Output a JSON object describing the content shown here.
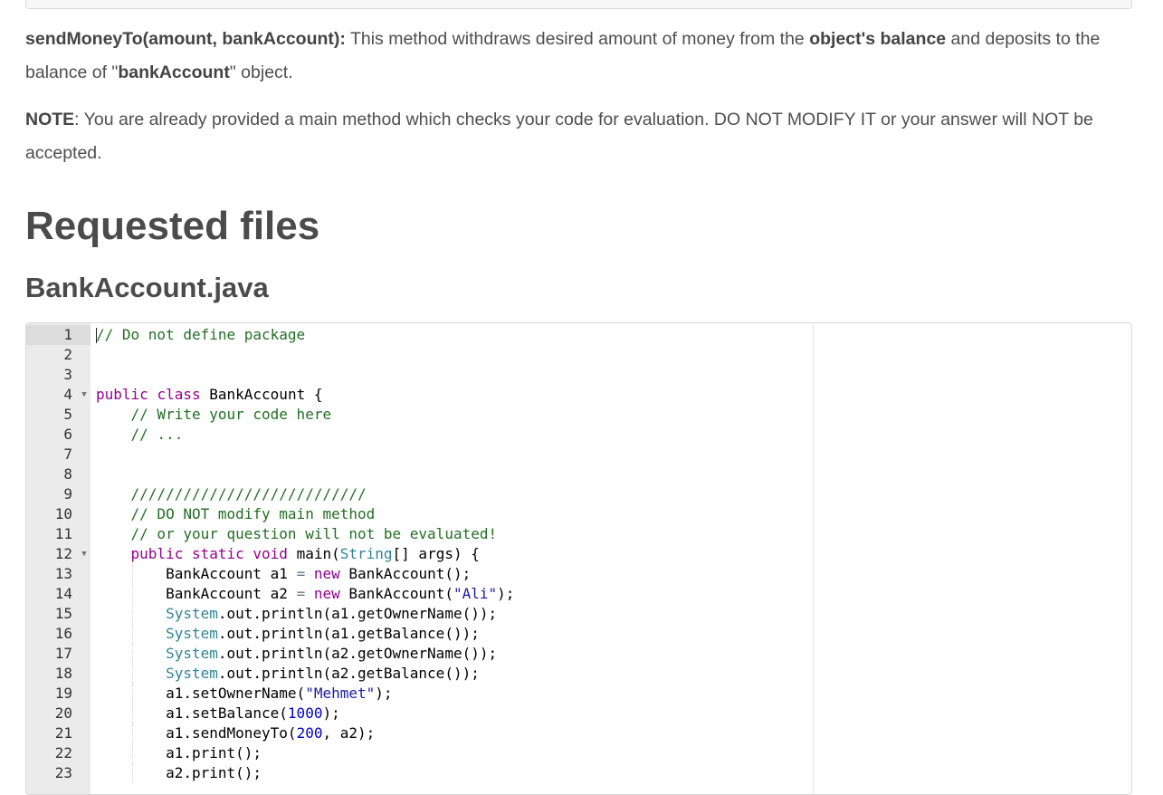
{
  "paragraphs": {
    "send_money": {
      "method_sig": "sendMoneyTo(amount, bankAccount):",
      "text_a": " This method withdraws desired amount of money from the ",
      "bold_a": "object's balance",
      "text_b": " and deposits to the balance of \"",
      "bold_b": "bankAccount",
      "text_c": "\" object."
    },
    "note": {
      "label": "NOTE",
      "text": ": You are already provided a main method which checks your code for evaluation. DO NOT MODIFY IT or your answer will NOT be accepted."
    }
  },
  "headings": {
    "section_title": "Requested files",
    "file_name": "BankAccount.java"
  },
  "editor": {
    "active_line": 1,
    "folded_markers": [
      4,
      12
    ],
    "lines": [
      {
        "n": "1",
        "tokens": [
          [
            "c",
            "// Do not define package"
          ]
        ]
      },
      {
        "n": "2",
        "tokens": []
      },
      {
        "n": "3",
        "tokens": []
      },
      {
        "n": "4",
        "tokens": [
          [
            "k",
            "public"
          ],
          [
            "",
            " "
          ],
          [
            "k",
            "class"
          ],
          [
            "",
            " BankAccount {"
          ]
        ]
      },
      {
        "n": "5",
        "tokens": [
          [
            "",
            "    "
          ],
          [
            "c",
            "// Write your code here"
          ]
        ]
      },
      {
        "n": "6",
        "tokens": [
          [
            "",
            "    "
          ],
          [
            "c",
            "// ..."
          ]
        ]
      },
      {
        "n": "7",
        "tokens": []
      },
      {
        "n": "8",
        "tokens": []
      },
      {
        "n": "9",
        "tokens": [
          [
            "",
            "    "
          ],
          [
            "c",
            "///////////////////////////"
          ]
        ]
      },
      {
        "n": "10",
        "tokens": [
          [
            "",
            "    "
          ],
          [
            "c",
            "// DO NOT modify main method"
          ]
        ]
      },
      {
        "n": "11",
        "tokens": [
          [
            "",
            "    "
          ],
          [
            "c",
            "// or your question will not be evaluated!"
          ]
        ]
      },
      {
        "n": "12",
        "tokens": [
          [
            "",
            "    "
          ],
          [
            "k",
            "public"
          ],
          [
            "",
            " "
          ],
          [
            "k",
            "static"
          ],
          [
            "",
            " "
          ],
          [
            "k",
            "void"
          ],
          [
            "",
            " main("
          ],
          [
            "t",
            "String"
          ],
          [
            "",
            "[] args) {"
          ]
        ]
      },
      {
        "n": "13",
        "tokens": [
          [
            "",
            "        BankAccount a1 "
          ],
          [
            "o",
            "="
          ],
          [
            "",
            " "
          ],
          [
            "k",
            "new"
          ],
          [
            "",
            " BankAccount();"
          ]
        ]
      },
      {
        "n": "14",
        "tokens": [
          [
            "",
            "        BankAccount a2 "
          ],
          [
            "o",
            "="
          ],
          [
            "",
            " "
          ],
          [
            "k",
            "new"
          ],
          [
            "",
            " BankAccount("
          ],
          [
            "s",
            "\"Ali\""
          ],
          [
            "",
            ");"
          ]
        ]
      },
      {
        "n": "15",
        "tokens": [
          [
            "",
            "        "
          ],
          [
            "t",
            "System"
          ],
          [
            "",
            ".out.println(a1.getOwnerName());"
          ]
        ]
      },
      {
        "n": "16",
        "tokens": [
          [
            "",
            "        "
          ],
          [
            "t",
            "System"
          ],
          [
            "",
            ".out.println(a1.getBalance());"
          ]
        ]
      },
      {
        "n": "17",
        "tokens": [
          [
            "",
            "        "
          ],
          [
            "t",
            "System"
          ],
          [
            "",
            ".out.println(a2.getOwnerName());"
          ]
        ]
      },
      {
        "n": "18",
        "tokens": [
          [
            "",
            "        "
          ],
          [
            "t",
            "System"
          ],
          [
            "",
            ".out.println(a2.getBalance());"
          ]
        ]
      },
      {
        "n": "19",
        "tokens": [
          [
            "",
            "        a1.setOwnerName("
          ],
          [
            "s",
            "\"Mehmet\""
          ],
          [
            "",
            ");"
          ]
        ]
      },
      {
        "n": "20",
        "tokens": [
          [
            "",
            "        a1.setBalance("
          ],
          [
            "n",
            "1000"
          ],
          [
            "",
            ");"
          ]
        ]
      },
      {
        "n": "21",
        "tokens": [
          [
            "",
            "        a1.sendMoneyTo("
          ],
          [
            "n",
            "200"
          ],
          [
            "",
            ", a2);"
          ]
        ]
      },
      {
        "n": "22",
        "tokens": [
          [
            "",
            "        a1.print();"
          ]
        ]
      },
      {
        "n": "23",
        "tokens": [
          [
            "",
            "        a2.print();"
          ]
        ]
      }
    ]
  }
}
